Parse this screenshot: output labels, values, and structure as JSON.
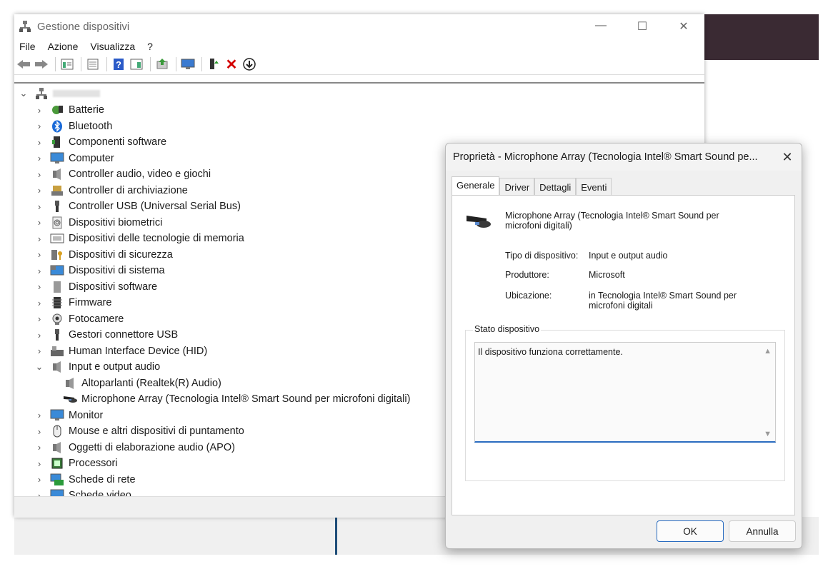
{
  "window": {
    "title": "Gestione dispositivi",
    "controls": {
      "minimize": "—",
      "maximize": "☐",
      "close": "✕"
    }
  },
  "menu": [
    "File",
    "Azione",
    "Visualizza",
    "?"
  ],
  "toolbar": {
    "icons": [
      "back-icon",
      "forward-icon",
      "properties-icon",
      "list-icon",
      "help-icon",
      "view-icon",
      "update-driver-icon",
      "scan-hardware-icon",
      "enable-device-icon",
      "uninstall-icon",
      "disable-icon"
    ],
    "uninstall_color": "#d40000"
  },
  "tree": {
    "root_label": "",
    "items": [
      {
        "label": "Batterie",
        "icon": "battery-icon",
        "expanded": false
      },
      {
        "label": "Bluetooth",
        "icon": "bluetooth-icon",
        "expanded": false
      },
      {
        "label": "Componenti software",
        "icon": "software-component-icon",
        "expanded": false
      },
      {
        "label": "Computer",
        "icon": "computer-icon",
        "expanded": false
      },
      {
        "label": "Controller audio, video e giochi",
        "icon": "speaker-icon",
        "expanded": false
      },
      {
        "label": "Controller di archiviazione",
        "icon": "storage-icon",
        "expanded": false
      },
      {
        "label": "Controller USB (Universal Serial Bus)",
        "icon": "usb-icon",
        "expanded": false
      },
      {
        "label": "Dispositivi biometrici",
        "icon": "fingerprint-icon",
        "expanded": false
      },
      {
        "label": "Dispositivi delle tecnologie di memoria",
        "icon": "memory-icon",
        "expanded": false
      },
      {
        "label": "Dispositivi di sicurezza",
        "icon": "security-key-icon",
        "expanded": false
      },
      {
        "label": "Dispositivi di sistema",
        "icon": "system-icon",
        "expanded": false
      },
      {
        "label": "Dispositivi software",
        "icon": "software-device-icon",
        "expanded": false
      },
      {
        "label": "Firmware",
        "icon": "firmware-icon",
        "expanded": false
      },
      {
        "label": "Fotocamere",
        "icon": "camera-icon",
        "expanded": false
      },
      {
        "label": "Gestori connettore USB",
        "icon": "usb-connector-icon",
        "expanded": false
      },
      {
        "label": "Human Interface Device (HID)",
        "icon": "hid-icon",
        "expanded": false
      },
      {
        "label": "Input e output audio",
        "icon": "speaker-icon",
        "expanded": true
      },
      {
        "label": "Altoparlanti (Realtek(R) Audio)",
        "icon": "speaker-icon",
        "child": true
      },
      {
        "label": "Microphone Array (Tecnologia Intel® Smart Sound per microfoni digitali)",
        "icon": "microphone-array-icon",
        "child": true
      },
      {
        "label": "Monitor",
        "icon": "monitor-icon",
        "expanded": false
      },
      {
        "label": "Mouse e altri dispositivi di puntamento",
        "icon": "mouse-icon",
        "expanded": false
      },
      {
        "label": "Oggetti di elaborazione audio (APO)",
        "icon": "speaker-icon",
        "expanded": false
      },
      {
        "label": "Processori",
        "icon": "processor-icon",
        "expanded": false
      },
      {
        "label": "Schede di rete",
        "icon": "network-icon",
        "expanded": false
      },
      {
        "label": "Schede video",
        "icon": "display-adapter-icon",
        "expanded": false
      }
    ]
  },
  "dialog": {
    "title": "Proprietà - Microphone Array (Tecnologia Intel® Smart Sound pe...",
    "close": "✕",
    "tabs": [
      "Generale",
      "Driver",
      "Dettagli",
      "Eventi"
    ],
    "active_tab": "Generale",
    "device_name": "Microphone Array (Tecnologia Intel® Smart Sound per microfoni digitali)",
    "device_name_line1": "Microphone Array (Tecnologia Intel® Smart Sound per",
    "device_name_line2": "microfoni digitali)",
    "fields": {
      "type_label": "Tipo di dispositivo:",
      "type_value": "Input e output audio",
      "manufacturer_label": "Produttore:",
      "manufacturer_value": "Microsoft",
      "location_label": "Ubicazione:",
      "location_value_line1": "in Tecnologia Intel® Smart Sound per",
      "location_value_line2": "microfoni digitali"
    },
    "status_group_label": "Stato dispositivo",
    "status_text": "Il dispositivo funziona correttamente.",
    "ok_label": "OK",
    "cancel_label": "Annulla"
  }
}
